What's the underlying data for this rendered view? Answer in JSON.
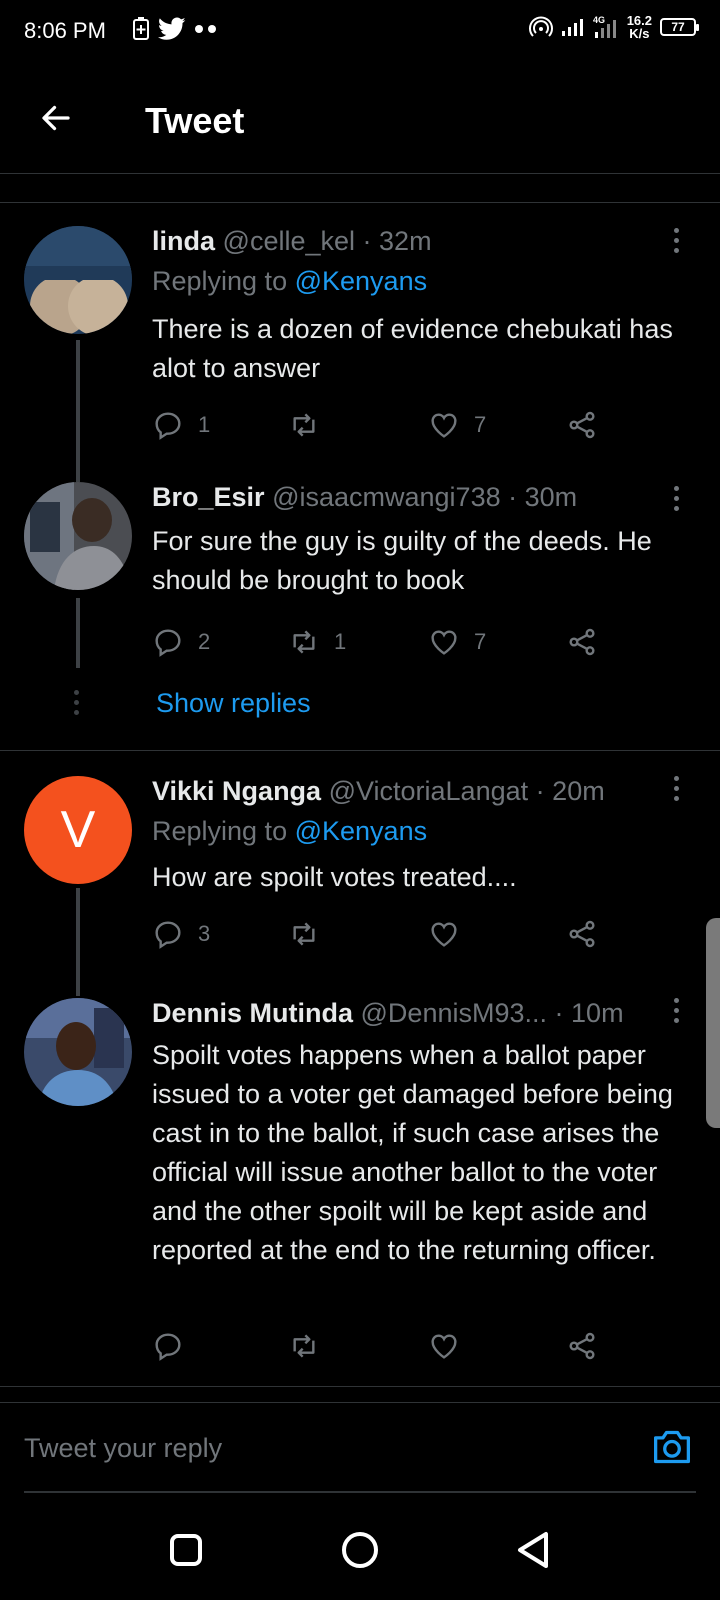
{
  "status_bar": {
    "time": "8:06 PM",
    "network_label": "4G",
    "speed_value": "16.2",
    "speed_unit": "K/s",
    "battery": "77"
  },
  "header": {
    "title": "Tweet"
  },
  "tweets": [
    {
      "name": "linda",
      "handle": "@celle_kel",
      "time": "32m",
      "replying_prefix": "Replying to",
      "replying_to": "@Kenyans",
      "text": "There is a dozen of evidence chebukati has alot to answer",
      "replies": "1",
      "retweets": "",
      "likes": "7"
    },
    {
      "name": "Bro_Esir",
      "handle": "@isaacmwangi738",
      "time": "30m",
      "text": "For sure the guy is guilty of the deeds. He should be brought to book",
      "replies": "2",
      "retweets": "1",
      "likes": "7"
    },
    {
      "name": "Vikki Nganga",
      "handle": "@VictoriaLangat",
      "time": "20m",
      "avatar_letter": "V",
      "replying_prefix": "Replying to",
      "replying_to": "@Kenyans",
      "text": "How are spoilt votes treated....",
      "replies": "3",
      "retweets": "",
      "likes": ""
    },
    {
      "name": "Dennis Mutinda",
      "handle": "@DennisM93...",
      "time": "10m",
      "text": "Spoilt votes happens when a ballot paper issued to a voter get damaged before being cast in to the ballot, if such case arises the official will issue another ballot to the voter and the other spoilt will be kept aside and reported at the end to the returning officer.",
      "replies": "",
      "retweets": "",
      "likes": ""
    }
  ],
  "show_replies": "Show replies",
  "reply_composer": {
    "placeholder": "Tweet your reply"
  },
  "colors": {
    "accent": "#1d9bf0",
    "avatar_v": "#f4511e",
    "background": "#000000"
  },
  "icons": [
    "back-arrow-icon",
    "reply-icon",
    "retweet-icon",
    "like-icon",
    "share-icon",
    "more-icon",
    "camera-icon",
    "nav-recents-icon",
    "nav-home-icon",
    "nav-back-icon"
  ]
}
